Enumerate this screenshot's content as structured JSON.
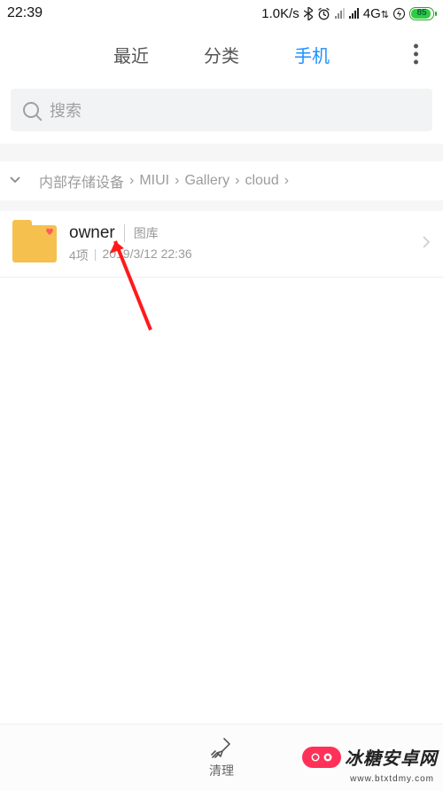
{
  "status": {
    "time": "22:39",
    "speed": "1.0K/s",
    "network": "4G",
    "battery": "85"
  },
  "tabs": {
    "items": [
      "最近",
      "分类",
      "手机"
    ],
    "active_index": 2
  },
  "search": {
    "placeholder": "搜索"
  },
  "breadcrumb": {
    "segments": [
      "内部存储设备",
      "MIUI",
      "Gallery",
      "cloud"
    ]
  },
  "list": {
    "items": [
      {
        "title": "owner",
        "tag": "图库",
        "count": "4项",
        "date": "2019/3/12 22:36"
      }
    ]
  },
  "bottom": {
    "clean": "清理"
  },
  "watermark": {
    "brand": "冰糖安卓网",
    "url": "www.btxtdmy.com"
  }
}
